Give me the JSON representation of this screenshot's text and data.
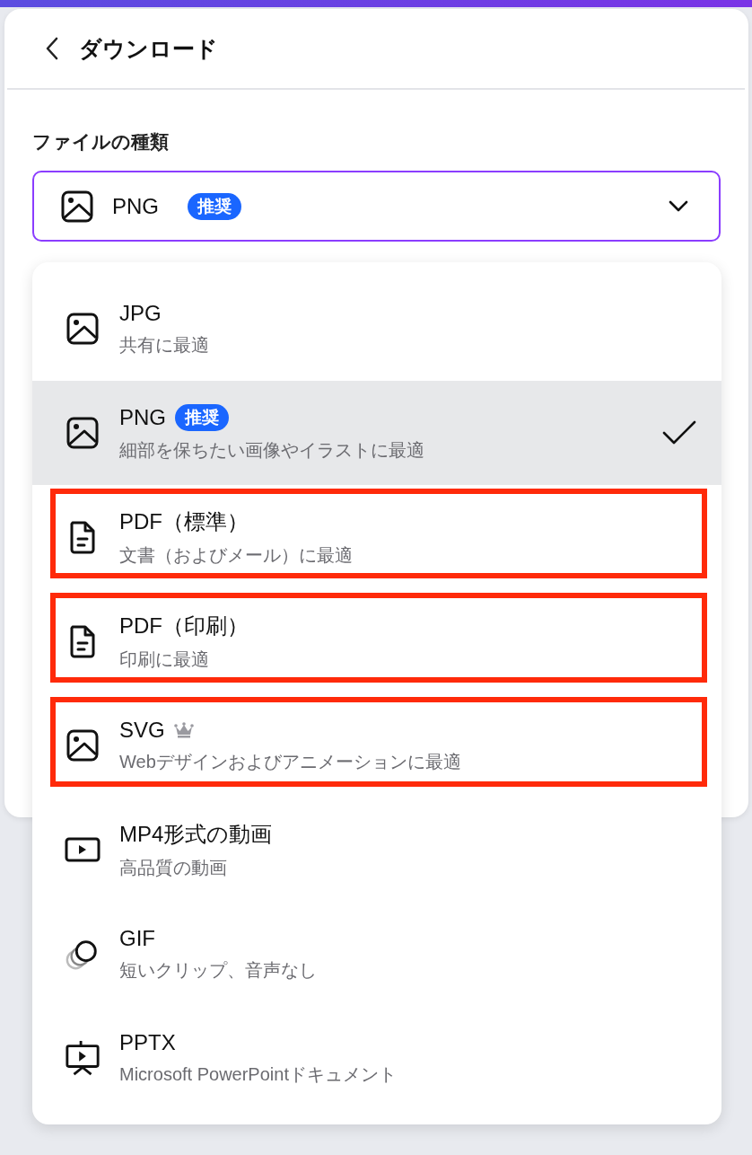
{
  "header": {
    "title": "ダウンロード"
  },
  "file_type": {
    "label": "ファイルの種類",
    "field": {
      "value": "PNG",
      "badge": "推奨",
      "kind": "image",
      "expanded": true
    }
  },
  "options": [
    {
      "kind": "image",
      "name": "JPG",
      "description": "共有に最適",
      "selected": false,
      "highlighted": false
    },
    {
      "kind": "image",
      "name": "PNG",
      "badge": "推奨",
      "description": "細部を保ちたい画像やイラストに最適",
      "selected": true,
      "highlighted": false
    },
    {
      "kind": "document",
      "name": "PDF（標準）",
      "description": "文書（およびメール）に最適",
      "selected": false,
      "highlighted": true
    },
    {
      "kind": "document",
      "name": "PDF（印刷）",
      "description": "印刷に最適",
      "selected": false,
      "highlighted": true
    },
    {
      "kind": "image",
      "name": "SVG",
      "premium": true,
      "description": "Webデザインおよびアニメーションに最適",
      "selected": false,
      "highlighted": true
    },
    {
      "kind": "video",
      "name": "MP4形式の動画",
      "description": "高品質の動画",
      "selected": false,
      "highlighted": false
    },
    {
      "kind": "gif",
      "name": "GIF",
      "description": "短いクリップ、音声なし",
      "selected": false,
      "highlighted": false
    },
    {
      "kind": "presentation",
      "name": "PPTX",
      "description": "Microsoft PowerPointドキュメント",
      "selected": false,
      "highlighted": false
    }
  ]
}
